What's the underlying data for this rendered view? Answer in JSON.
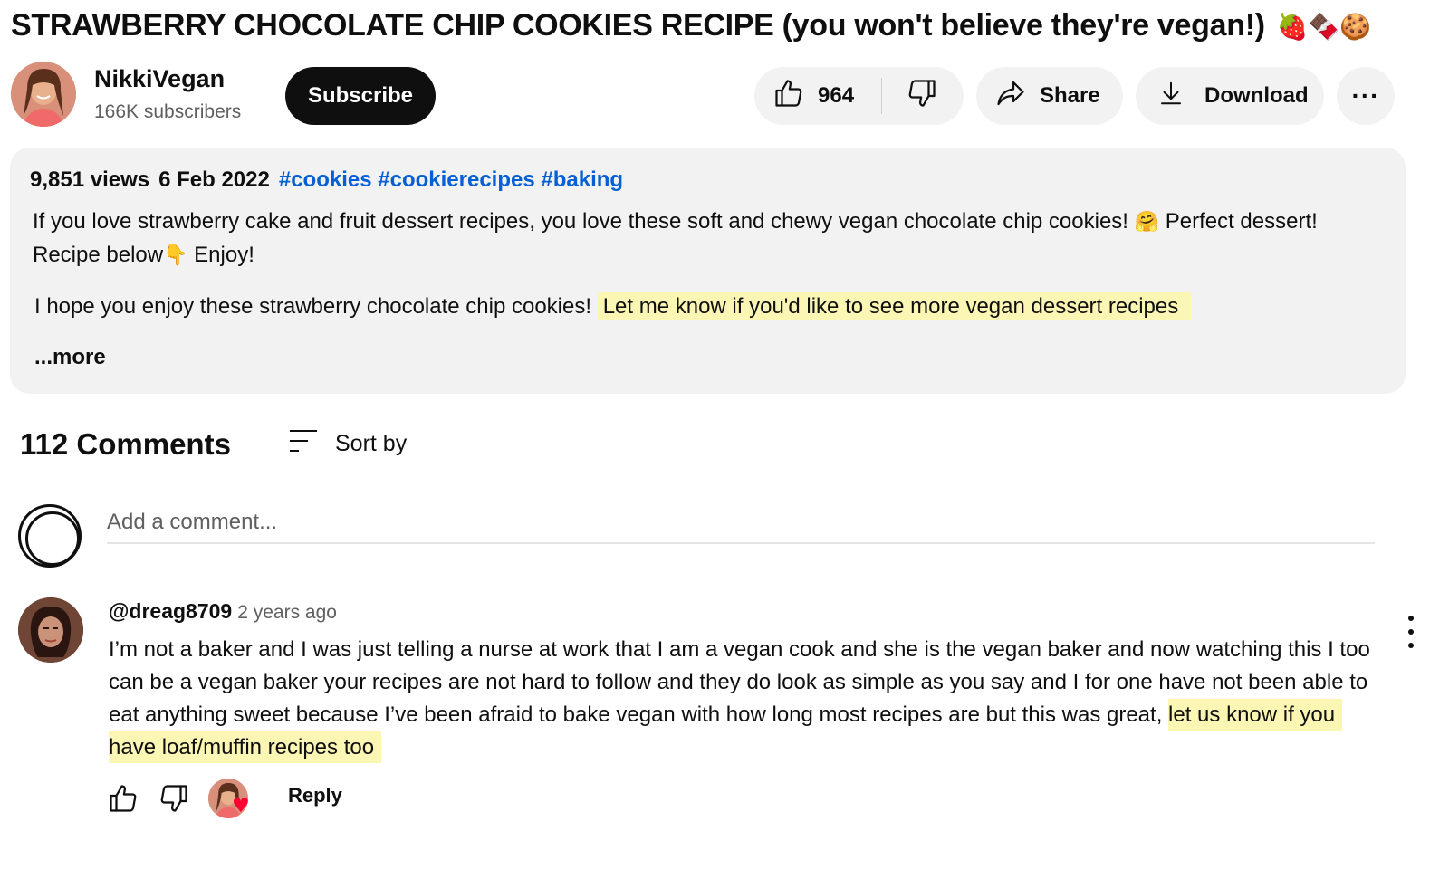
{
  "video": {
    "title": "STRAWBERRY CHOCOLATE CHIP COOKIES RECIPE (you won't believe they're vegan!)",
    "title_emoji": "🍓🍫🍪"
  },
  "channel": {
    "name": "NikkiVegan",
    "subscribers": "166K subscribers",
    "subscribe_label": "Subscribe"
  },
  "actions": {
    "like_count": "964",
    "share_label": "Share",
    "download_label": "Download",
    "more_label": "···"
  },
  "description": {
    "views": "9,851 views",
    "date": "6 Feb 2022",
    "hashtags": "#cookies #cookierecipes #baking",
    "para1_a": "If you love strawberry cake and fruit dessert recipes, you love these soft and chewy vegan chocolate chip cookies! ",
    "para1_emoji1": "🤗",
    "para1_b": " Perfect dessert! Recipe below",
    "para1_emoji2": "👇",
    "para1_c": " Enjoy!",
    "para2_plain": "I hope you enjoy these strawberry chocolate chip cookies! ",
    "para2_highlight": "Let me know if you'd like to see more vegan dessert recipes",
    "more_label": "...more"
  },
  "comments": {
    "count_label": "112 Comments",
    "sort_label": "Sort by",
    "add_placeholder": "Add a comment...",
    "items": [
      {
        "author": "@dreag8709",
        "time": "2 years ago",
        "text_plain": "I’m not a baker and I was just telling a nurse at work that I am a vegan cook and she is the vegan baker and now watching this I too can be a vegan baker your recipes are not hard to follow and they do look as simple as you say and I for one have not been able to eat anything sweet because I’ve been afraid to bake vegan with how long most recipes are but this was great, ",
        "text_highlight": "let us know if you have loaf/muffin recipes too",
        "reply_label": "Reply",
        "creator_heart": true
      }
    ]
  },
  "colors": {
    "accent_link": "#065fd4",
    "highlight": "#fbf6b3",
    "pill_bg": "#f2f2f2",
    "subscribe_bg": "#0f0f0f",
    "heart": "#ff0033"
  },
  "icons": [
    "thumbs-up-icon",
    "thumbs-down-icon",
    "share-icon",
    "download-icon",
    "more-icon",
    "sort-icon",
    "kebab-menu-icon",
    "heart-icon"
  ]
}
